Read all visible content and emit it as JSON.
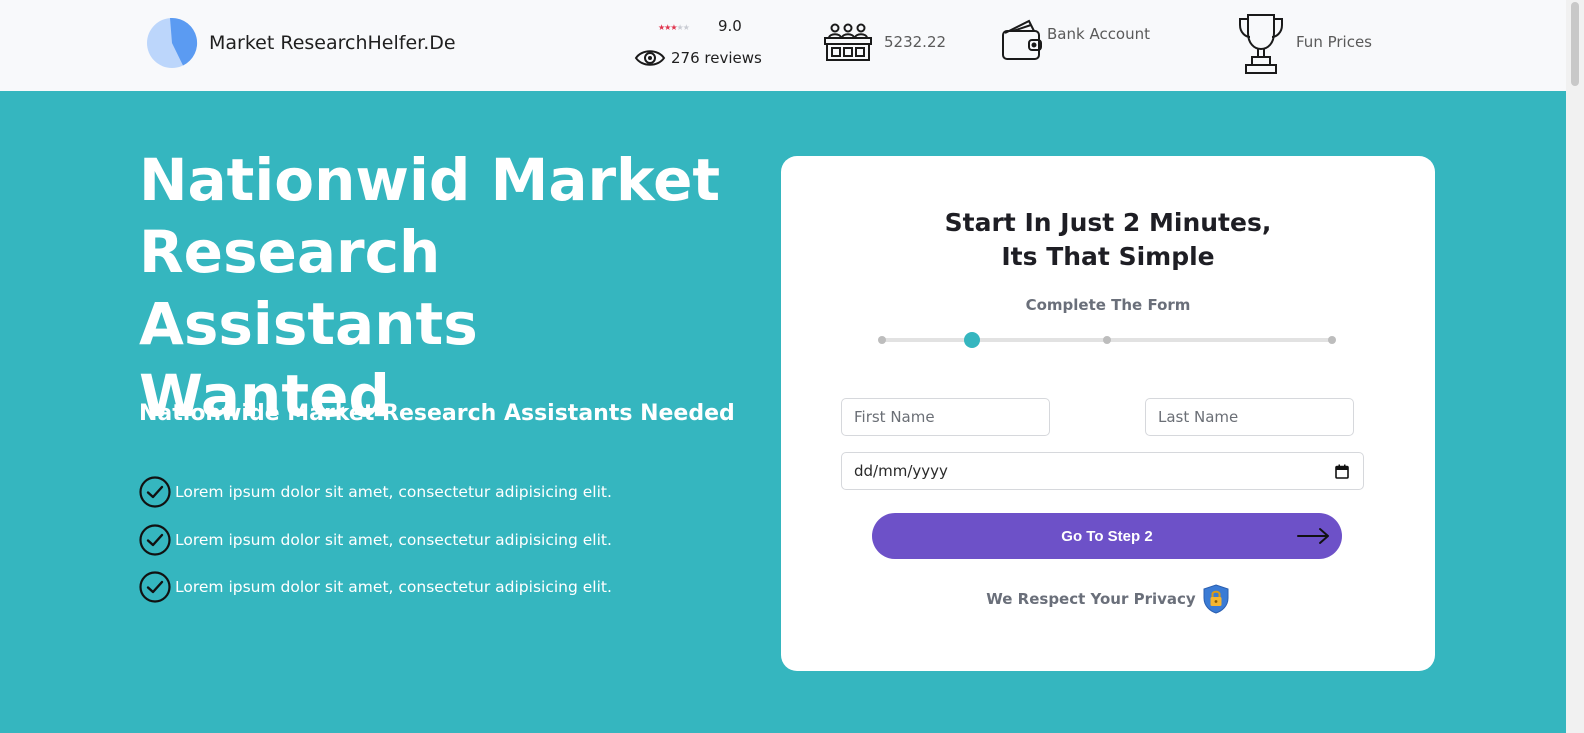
{
  "header": {
    "logo_text": "Market ResearchHelfer.De",
    "rating": {
      "stars": "★★★★★",
      "filled_stars": 3,
      "score": "9.0",
      "reviews": "276 reviews"
    },
    "stats": [
      {
        "icon": "auction-table-icon",
        "label": "5232.22"
      },
      {
        "icon": "wallet-icon",
        "label": "Bank Account"
      },
      {
        "icon": "trophy-icon",
        "label": "Fun Prices"
      }
    ]
  },
  "hero": {
    "title": "Nationwid Market Research Assistants Wanted",
    "subtitle": "Nationwide Market Research Assistants Needed",
    "benefits": [
      "Lorem ipsum dolor sit amet, consectetur adipisicing elit.",
      "Lorem ipsum dolor sit amet, consectetur adipisicing elit.",
      "Lorem ipsum dolor sit amet, consectetur adipisicing elit."
    ]
  },
  "form": {
    "title_line1": "Start In Just 2 Minutes,",
    "title_line2": "Its That Simple",
    "progress_label": "Complete The Form",
    "progress": {
      "steps": 4,
      "current_step": 2
    },
    "first_name_placeholder": "First Name",
    "last_name_placeholder": "Last Name",
    "date_placeholder": "dd/mm/yyyy",
    "submit_label": "Go To Step 2",
    "privacy_text": "We Respect Your Privacy"
  },
  "colors": {
    "background": "#35b6bf",
    "accent": "#6d51c8",
    "progress_active": "#35b6bf",
    "shield": "#3a7bd5"
  }
}
